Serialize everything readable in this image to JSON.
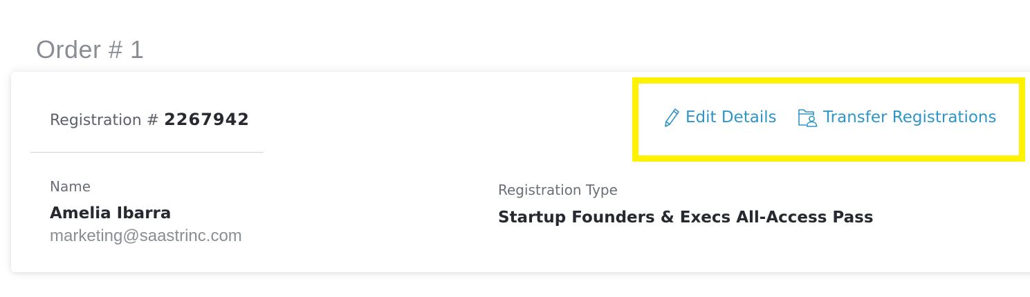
{
  "order": {
    "title": "Order # 1"
  },
  "registration": {
    "label": "Registration #",
    "number": "2267942"
  },
  "actions": {
    "edit": {
      "label": "Edit Details",
      "icon": "pencil-icon"
    },
    "transfer": {
      "label": "Transfer Registrations",
      "icon": "folder-user-icon"
    }
  },
  "attendee": {
    "name_label": "Name",
    "name": "Amelia Ibarra",
    "email": "marketing@saastrinc.com"
  },
  "registration_type": {
    "label": "Registration Type",
    "value": "Startup Founders & Execs All-Access Pass"
  },
  "colors": {
    "link": "#2f95c7",
    "highlight": "#fff200",
    "heading": "#8a8e94",
    "text_strong": "#26292f"
  }
}
